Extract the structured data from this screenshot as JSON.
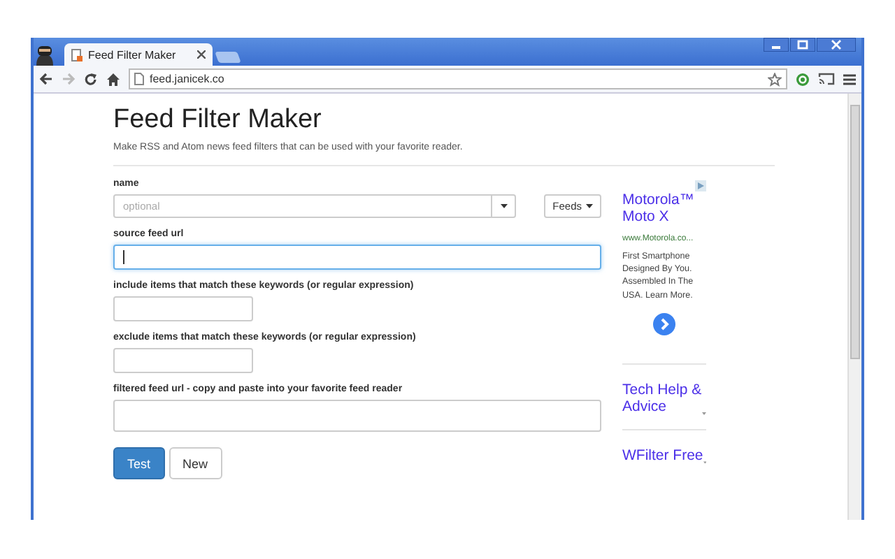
{
  "browser": {
    "tab_title": "Feed Filter Maker",
    "address": "feed.janicek.co"
  },
  "page": {
    "title": "Feed Filter Maker",
    "subtitle": "Make RSS and Atom news feed filters that can be used with your favorite reader.",
    "fields": [
      {
        "kind": "combo",
        "label": "name",
        "placeholder": "optional",
        "focused": false,
        "menu_button": "Feeds"
      },
      {
        "kind": "wide",
        "label": "source feed url",
        "focused": true
      },
      {
        "kind": "short",
        "label": "include items that match these keywords (or regular expression)",
        "focused": false
      },
      {
        "kind": "short",
        "label": "exclude items that match these keywords (or regular expression)",
        "focused": false
      },
      {
        "kind": "tall",
        "label": "filtered feed url - copy and paste into your favorite feed reader",
        "focused": false
      }
    ],
    "buttons": [
      {
        "label": "Test",
        "primary": true
      },
      {
        "label": "New",
        "primary": false
      }
    ]
  },
  "ads": [
    {
      "kind": "ad",
      "title": "Motorola™ Moto X",
      "url": "www.Motorola.co...",
      "text": "First Smartphone Designed By You. Assembled In The USA. Learn More."
    },
    {
      "kind": "link",
      "title": "Tech Help & Advice"
    },
    {
      "kind": "link",
      "title": "WFilter Free"
    }
  ]
}
